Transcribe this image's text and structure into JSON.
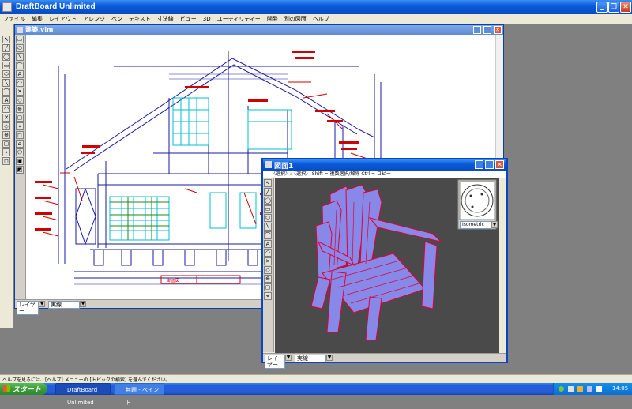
{
  "app": {
    "title": "DraftBoard Unlimited",
    "menus": [
      "ファイル",
      "編集",
      "レイアウト",
      "アレンジ",
      "ペン",
      "テキスト",
      "寸法線",
      "ビュー",
      "3D",
      "ユーティリティー",
      "開発",
      "別の図面",
      "ヘルプ"
    ]
  },
  "doc_left": {
    "title": "建築.vlm",
    "layer_label": "レイヤー",
    "line_style": "実線",
    "title_block": "断面図"
  },
  "doc_right": {
    "title": "図面1",
    "hint": "〈選択〉:〈選択〉 Shift = 複数選択/解除 Ctrl = コピー",
    "view_mode": "Isometric",
    "layer_label": "レイヤー",
    "line_style": "実線"
  },
  "status_bar": {
    "text": "ヘルプを見るには、[ヘルプ] メニューの [トピックの検索] を選んでください。"
  },
  "taskbar": {
    "start_label": "スタート",
    "tasks": [
      "DraftBoard Unlimited",
      "無題 - ペイント"
    ],
    "clock": "14:05"
  },
  "colors": {
    "xp_blue": "#0a5bd8",
    "drawing_line": "#1a1aa0",
    "red_annotation": "#d00000",
    "cyan_window": "#00c0d0",
    "chair_fill": "#8888e8",
    "chair_edge": "#e0003a",
    "viewport_bg": "#4a4a4a"
  }
}
